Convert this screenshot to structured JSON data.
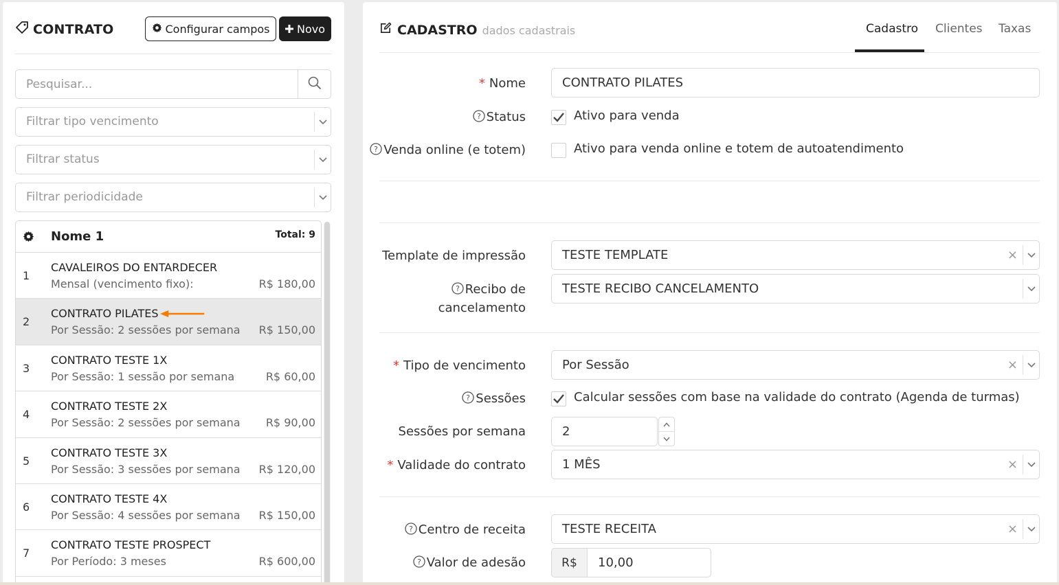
{
  "left": {
    "title": "CONTRATO",
    "config_button": "Configurar campos",
    "new_button": "Novo",
    "search_placeholder": "Pesquisar...",
    "filters": [
      "Filtrar tipo vencimento",
      "Filtrar status",
      "Filtrar periodicidade"
    ],
    "list": {
      "header_name": "Nome 1",
      "header_total": "Total: 9",
      "rows": [
        {
          "num": "1",
          "name": "CAVALEIROS DO ENTARDECER",
          "sub": "Mensal (vencimento fixo):",
          "price": "R$ 180,00"
        },
        {
          "num": "2",
          "name": "CONTRATO PILATES",
          "sub": "Por Sessão: 2 sessões por semana",
          "price": "R$ 150,00"
        },
        {
          "num": "3",
          "name": "CONTRATO TESTE 1X",
          "sub": "Por Sessão: 1 sessão por semana",
          "price": "R$ 60,00"
        },
        {
          "num": "4",
          "name": "CONTRATO TESTE 2X",
          "sub": "Por Sessão: 2 sessões por semana",
          "price": "R$ 90,00"
        },
        {
          "num": "5",
          "name": "CONTRATO TESTE 3X",
          "sub": "Por Sessão: 3 sessões por semana",
          "price": "R$ 120,00"
        },
        {
          "num": "6",
          "name": "CONTRATO TESTE 4X",
          "sub": "Por Sessão: 4 sessões por semana",
          "price": "R$ 150,00"
        },
        {
          "num": "7",
          "name": "CONTRATO TESTE PROSPECT",
          "sub": "Por Período: 3 meses",
          "price": "R$ 600,00"
        }
      ]
    }
  },
  "right": {
    "title": "CADASTRO",
    "subtitle": "dados cadastrais",
    "tabs": [
      "Cadastro",
      "Clientes",
      "Taxas"
    ],
    "form": {
      "nome_label": "Nome",
      "nome_value": "CONTRATO PILATES",
      "status_label": "Status",
      "status_check": "Ativo para venda",
      "online_label": "Venda online (e totem)",
      "online_check": "Ativo para venda online e totem de autoatendimento",
      "template_label": "Template de impressão",
      "template_value": "TESTE TEMPLATE",
      "recibo_label_1": "Recibo de",
      "recibo_label_2": "cancelamento",
      "recibo_value": "TESTE RECIBO CANCELAMENTO",
      "tipo_label": "Tipo de vencimento",
      "tipo_value": "Por Sessão",
      "sessoes_label": "Sessões",
      "sessoes_check": "Calcular sessões com base na validade do contrato (Agenda de turmas)",
      "sps_label": "Sessões por semana",
      "sps_value": "2",
      "validade_label": "Validade do contrato",
      "validade_value": "1 MÊS",
      "centro_label": "Centro de receita",
      "centro_value": "TESTE RECEITA",
      "adesao_label": "Valor de adesão",
      "adesao_prefix": "R$",
      "adesao_value": "10,00"
    },
    "clear_glyph": "×",
    "required_mark": "*"
  },
  "colors": {
    "accent_dark": "#1f1f1f",
    "required": "#e53935",
    "arrow": "#f57c00"
  }
}
